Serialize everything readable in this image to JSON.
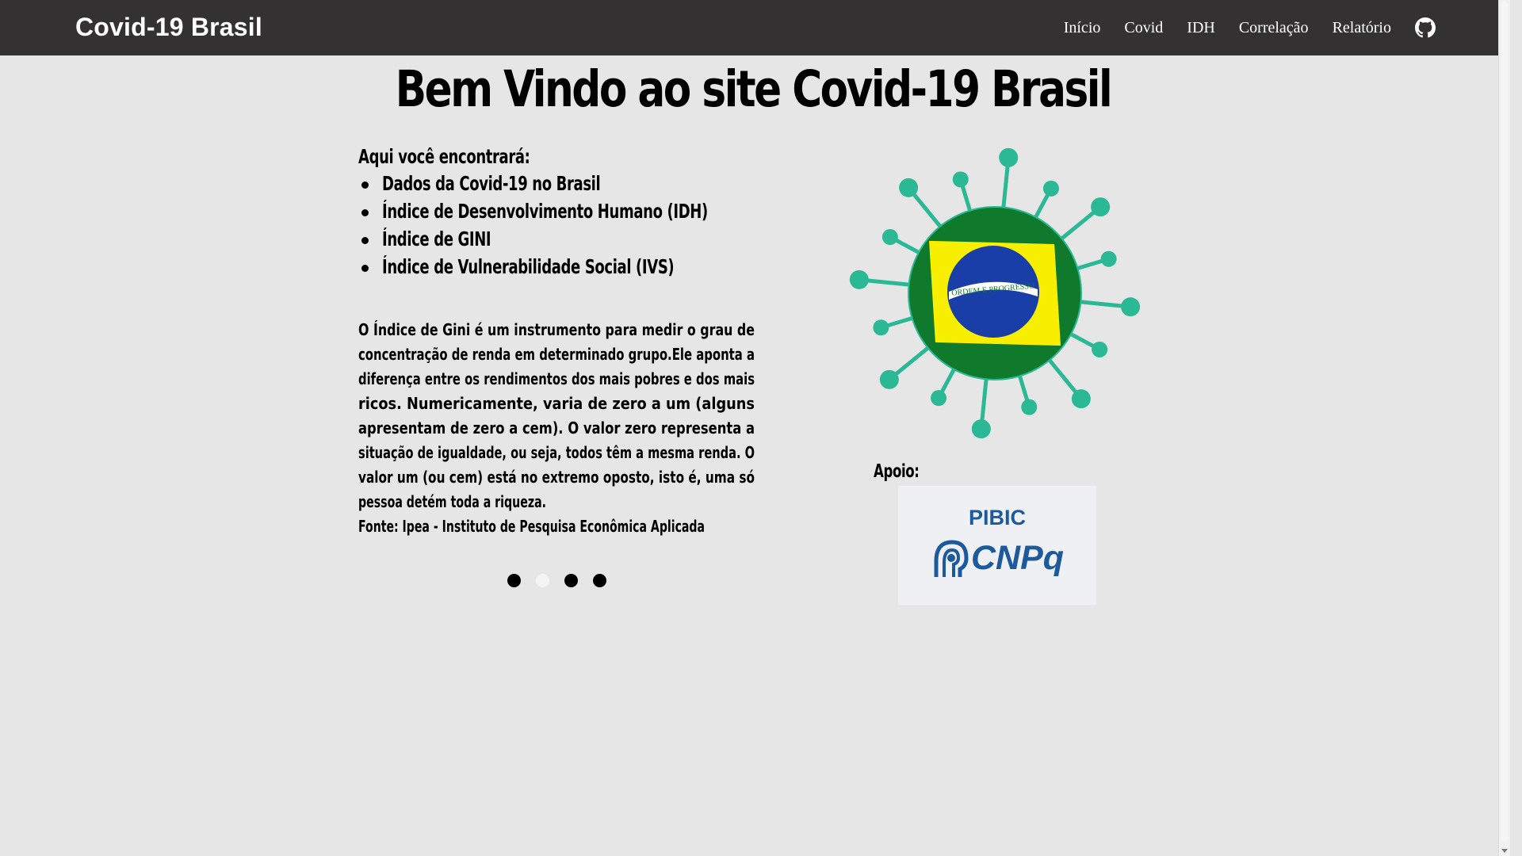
{
  "navbar": {
    "brand": "Covid-19 Brasil",
    "links": [
      {
        "label": "Início"
      },
      {
        "label": "Covid"
      },
      {
        "label": "IDH"
      },
      {
        "label": "Correlação"
      },
      {
        "label": "Relatório"
      }
    ],
    "github_icon": "github-icon",
    "background_color": "#333131"
  },
  "main": {
    "headline": "Bem Vindo ao site Covid-19 Brasil",
    "intro": "Aqui você encontrará:",
    "features": [
      "Dados da Covid-19 no Brasil",
      "Índice de Desenvolvimento Humano (IDH)",
      "Índice de GINI",
      "Índice de Vulnerabilidade Social (IVS)"
    ],
    "gini_paragraph_lines": [
      "O Índice de Gini é um instrumento para medir o grau de",
      "concentração de renda em determinado grupo.Ele aponta a",
      "diferença entre os rendimentos dos mais pobres e dos mais",
      "ricos. Numericamente, varia de zero a um (alguns",
      "apresentam de zero a cem). O valor zero representa a",
      "situação de igualdade, ou seja, todos têm a mesma renda. O",
      "valor um (ou cem) está no extremo oposto, isto é, uma só",
      "pessoa detém toda a riqueza."
    ],
    "source": "Fonte: Ipea - Instituto de Pesquisa Econômica Aplicada",
    "carousel": {
      "slide_count": 4,
      "active_index": 1
    }
  },
  "illustration": {
    "icon": "covid-brazil-flag-icon",
    "flag_motto": "ORDEM E PROGRESSO",
    "virus_color": "#2bb894",
    "flag_green": "#0f7a2c",
    "flag_yellow": "#f7ee00",
    "flag_blue": "#1a3ea8"
  },
  "support": {
    "label": "Apoio:",
    "pibic": "PIBIC",
    "cnpq": "CNPq",
    "cnpq_icon": "cnpq-head-icon",
    "brand_color": "#1c5a9b"
  }
}
